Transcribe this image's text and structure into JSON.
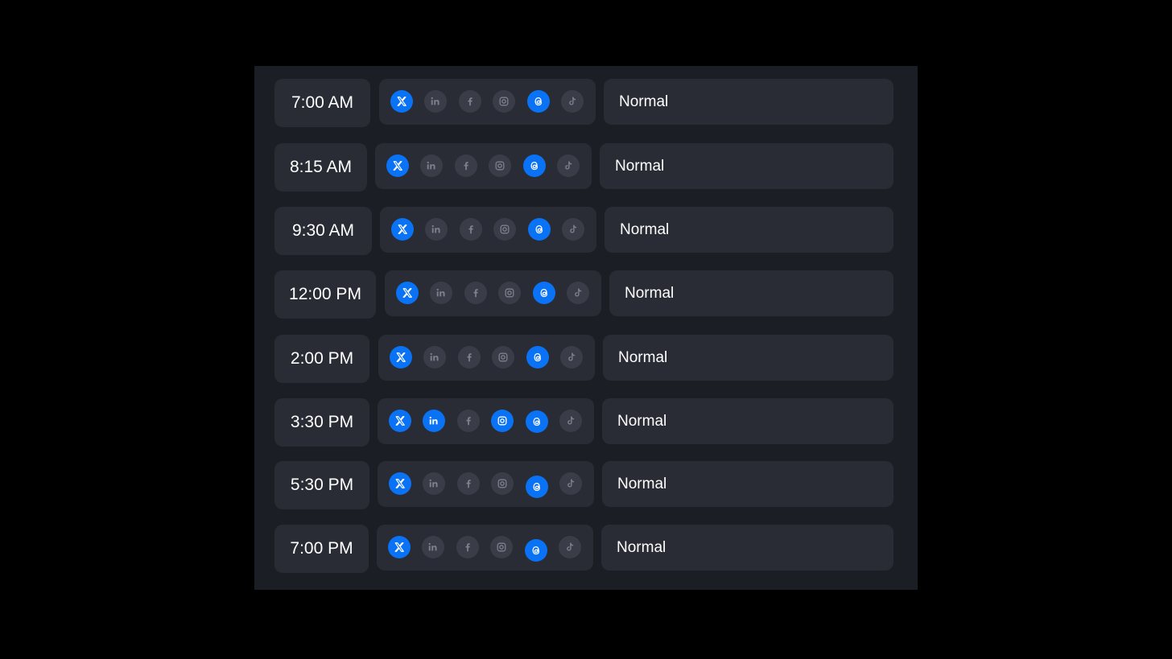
{
  "colors": {
    "background": "#000000",
    "panel": "#1c1e25",
    "card": "#2a2c35",
    "icon_inactive": "#3a3d48",
    "icon_inactive_glyph": "#7d818e",
    "icon_active": "#0a72f5",
    "text": "#ffffff"
  },
  "platforms": [
    "x",
    "linkedin",
    "facebook",
    "instagram",
    "threads",
    "tiktok"
  ],
  "schedule": [
    {
      "time": "7:00 AM",
      "priority": "Normal",
      "active": [
        "x",
        "threads"
      ]
    },
    {
      "time": "8:15 AM",
      "priority": "Normal",
      "active": [
        "x",
        "threads"
      ]
    },
    {
      "time": "9:30 AM",
      "priority": "Normal",
      "active": [
        "x",
        "threads"
      ]
    },
    {
      "time": "12:00 PM",
      "priority": "Normal",
      "active": [
        "x",
        "threads"
      ]
    },
    {
      "time": "2:00 PM",
      "priority": "Normal",
      "active": [
        "x",
        "threads"
      ]
    },
    {
      "time": "3:30 PM",
      "priority": "Normal",
      "active": [
        "x",
        "linkedin",
        "instagram",
        "threads"
      ]
    },
    {
      "time": "5:30 PM",
      "priority": "Normal",
      "active": [
        "x",
        "threads"
      ]
    },
    {
      "time": "7:00 PM",
      "priority": "Normal",
      "active": [
        "x",
        "threads"
      ]
    }
  ]
}
